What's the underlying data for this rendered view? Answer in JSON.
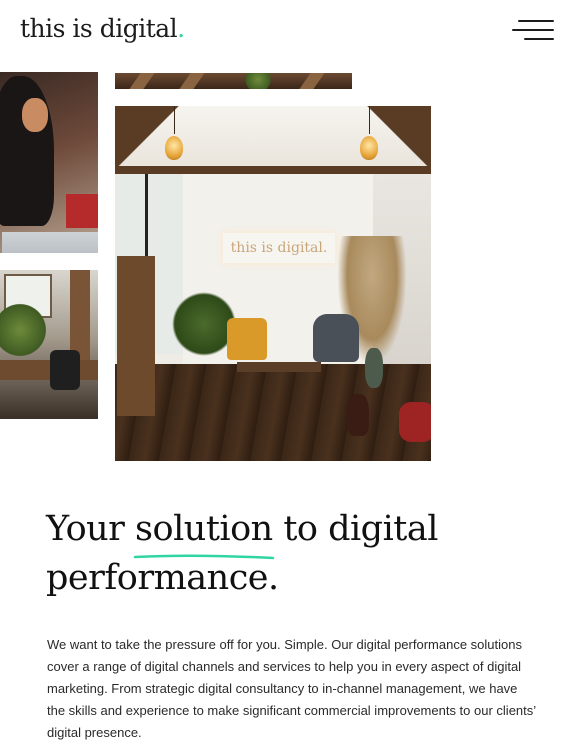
{
  "header": {
    "logo_text": "this is digital",
    "logo_dot": "."
  },
  "menu": {
    "icon": "hamburger-menu-icon"
  },
  "gallery": {
    "sign_text": "this is digital."
  },
  "hero": {
    "heading_before": "Your ",
    "heading_highlight": "solution",
    "heading_after": " to digital performance.",
    "body": "We want to take the pressure off for you. Simple. Our digital performance solutions cover a range of digital channels and services to help you in every aspect of digital marketing. From strategic digital consultancy to in-channel management, we have the skills and experience to make significant commercial improvements to our clients’ digital presence."
  },
  "colors": {
    "accent": "#2fd6a4",
    "text": "#1a1a1a",
    "background": "#ffffff"
  }
}
